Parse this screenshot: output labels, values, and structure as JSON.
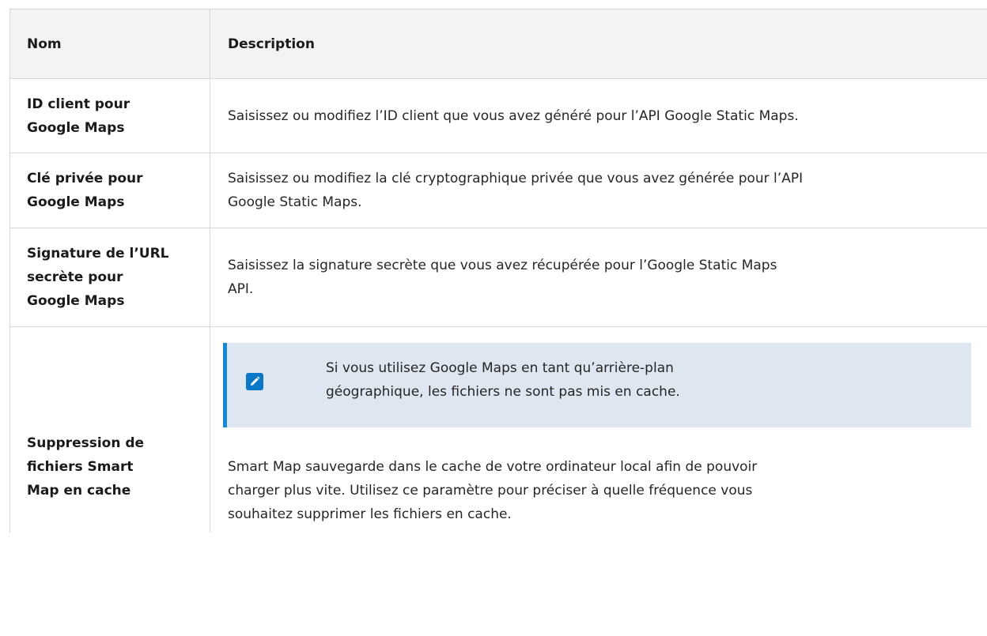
{
  "table": {
    "headers": {
      "name": "Nom",
      "description": "Description"
    },
    "rows": [
      {
        "name_lines": [
          "ID client pour",
          "Google Maps"
        ],
        "description_lines": [
          "Saisissez ou modifiez l’ID client que vous avez généré pour l’API Google Static Maps."
        ]
      },
      {
        "name_lines": [
          "Clé privée pour",
          "Google Maps"
        ],
        "description_lines": [
          "Saisissez ou modifiez la clé cryptographique privée que vous avez générée pour l’API",
          "Google Static Maps."
        ]
      },
      {
        "name_lines": [
          "Signature de l’URL",
          "secrète pour",
          "Google Maps"
        ],
        "description_lines": [
          "Saisissez la signature secrète que vous avez récupérée pour l’Google Static Maps",
          "API."
        ]
      },
      {
        "name_lines": [
          "Suppression de",
          "fichiers Smart",
          "Map en cache"
        ],
        "note": {
          "icon": "pencil-icon",
          "lines": [
            "Si vous utilisez Google Maps en tant qu’arrière-plan",
            "géographique, les fichiers ne sont pas mis en cache."
          ]
        },
        "description_lines": [
          "Smart Map sauvegarde dans le cache de votre ordinateur local afin de pouvoir",
          "charger plus vite. Utilisez ce paramètre pour préciser à quelle fréquence vous",
          "souhaitez supprimer les fichiers en cache."
        ]
      }
    ]
  },
  "colors": {
    "header_bg": "#f3f3f3",
    "border": "#d7d7d7",
    "note_bg": "#dde6f1",
    "note_accent": "#1487d6"
  }
}
